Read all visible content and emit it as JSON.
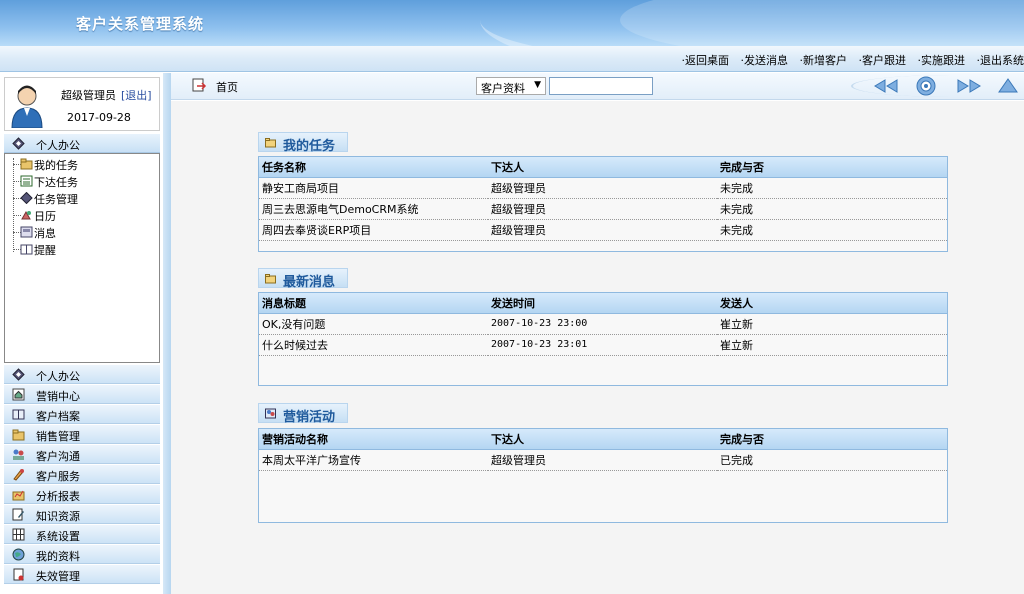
{
  "app": {
    "title": "客户关系管理系统"
  },
  "topnav": {
    "items": [
      "·返回桌面",
      "·发送消息",
      "·新增客户",
      "·客户跟进",
      "·实施跟进",
      "·退出系统"
    ]
  },
  "user": {
    "name": "超级管理员",
    "logout": "[退出]",
    "date": "2017-09-28"
  },
  "sidebar": {
    "section_title": "个人办公",
    "tree": [
      "我的任务",
      "下达任务",
      "任务管理",
      "日历",
      "消息",
      "提醒"
    ],
    "menu": [
      "个人办公",
      "营销中心",
      "客户档案",
      "销售管理",
      "客户沟通",
      "客户服务",
      "分析报表",
      "知识资源",
      "系统设置",
      "我的资料",
      "失效管理"
    ]
  },
  "toolbar": {
    "home": "首页",
    "search_select": "客户资料",
    "search_value": ""
  },
  "tasks": {
    "title": "我的任务",
    "headers": [
      "任务名称",
      "下达人",
      "完成与否"
    ],
    "rows": [
      [
        "静安工商局项目",
        "超级管理员",
        "未完成"
      ],
      [
        "周三去思源电气DemoCRM系统",
        "超级管理员",
        "未完成"
      ],
      [
        "周四去奉贤谈ERP项目",
        "超级管理员",
        "未完成"
      ]
    ]
  },
  "messages": {
    "title": "最新消息",
    "headers": [
      "消息标题",
      "发送时间",
      "发送人"
    ],
    "rows": [
      [
        "OK,没有问题",
        "2007-10-23 23:00",
        "崔立新"
      ],
      [
        "什么时候过去",
        "2007-10-23 23:01",
        "崔立新"
      ]
    ]
  },
  "campaigns": {
    "title": "营销活动",
    "headers": [
      "营销活动名称",
      "下达人",
      "完成与否"
    ],
    "rows": [
      [
        "本周太平洋广场宣传",
        "超级管理员",
        "已完成"
      ]
    ]
  },
  "colors": {
    "accent": "#1f5a9c",
    "header": "#5f9fdc",
    "panel_border": "#8fb9df"
  }
}
